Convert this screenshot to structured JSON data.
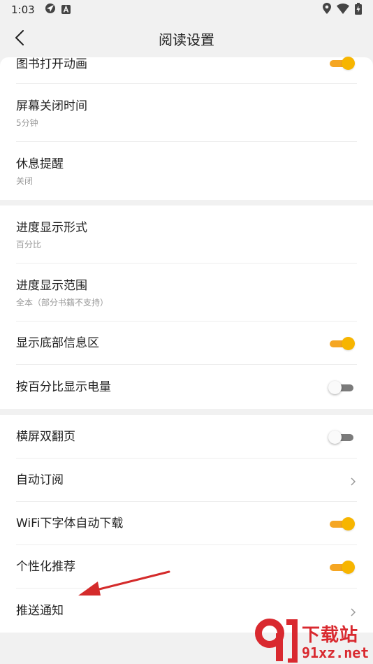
{
  "status_bar": {
    "time": "1:03",
    "icons": [
      "nav-app-icon",
      "a-badge-icon",
      "location-icon",
      "wifi-icon",
      "battery-icon"
    ]
  },
  "app_bar": {
    "title": "阅读设置",
    "back_icon": "chevron-left-icon"
  },
  "colors": {
    "accent": "#F7B500",
    "toggle_off_track": "#7B7B7B",
    "background": "#F1F1F1",
    "annotation_arrow": "#D42B2B"
  },
  "sections": [
    {
      "rows": [
        {
          "title": "图书打开动画",
          "control": "toggle",
          "on": true
        },
        {
          "title": "屏幕关闭时间",
          "subtitle": "5分钟"
        },
        {
          "title": "休息提醒",
          "subtitle": "关闭"
        }
      ]
    },
    {
      "rows": [
        {
          "title": "进度显示形式",
          "subtitle": "百分比"
        },
        {
          "title": "进度显示范围",
          "subtitle": "全本（部分书籍不支持）"
        },
        {
          "title": "显示底部信息区",
          "control": "toggle",
          "on": true
        },
        {
          "title": "按百分比显示电量",
          "control": "toggle",
          "on": false
        }
      ]
    },
    {
      "rows": [
        {
          "title": "横屏双翻页",
          "control": "toggle",
          "on": false
        },
        {
          "title": "自动订阅",
          "control": "chevron"
        },
        {
          "title": "WiFi下字体自动下载",
          "control": "toggle",
          "on": true
        },
        {
          "title": "个性化推荐",
          "control": "toggle",
          "on": true
        },
        {
          "title": "推送通知",
          "control": "chevron"
        }
      ]
    }
  ],
  "watermark": {
    "top_text": "下载站",
    "bottom_text": "91xz.net"
  }
}
